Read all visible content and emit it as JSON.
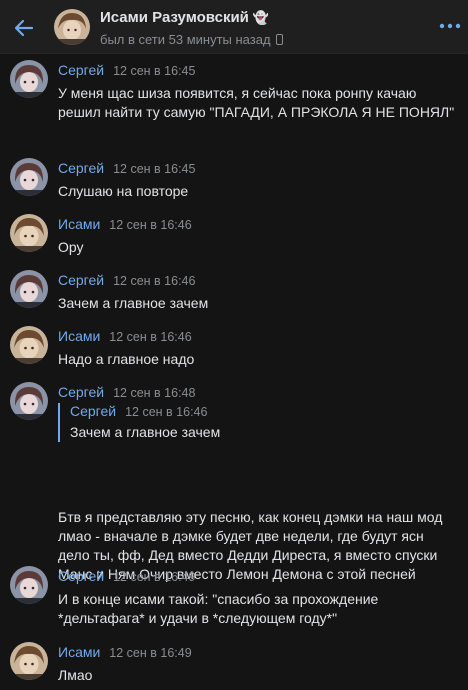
{
  "header": {
    "title": "Исами Разумовский",
    "title_icon": "ghost-icon",
    "status": "был в сети 53 минуты назад"
  },
  "colors": {
    "accent": "#71aaeb",
    "background": "#141414",
    "header_bg": "#1f1f1f"
  },
  "messages": [
    {
      "author": "Сергей",
      "time": "12 сен в 16:45",
      "text": "У меня щас шиза появится, я сейчас пока ронпу качаю решил найти ту самую \"ПАГАДИ, А ПРЭКОЛА Я НЕ ПОНЯЛ\""
    },
    {
      "author": "Сергей",
      "time": "12 сен в 16:45",
      "text": "Слушаю на повторе"
    },
    {
      "author": "Исами",
      "time": "12 сен в 16:46",
      "text": "Ору"
    },
    {
      "author": "Сергей",
      "time": "12 сен в 16:46",
      "text": "Зачем а главное зачем"
    },
    {
      "author": "Исами",
      "time": "12 сен в 16:46",
      "text": "Надо а главное надо"
    },
    {
      "author": "Сергей",
      "time": "12 сен в 16:48",
      "quote": {
        "author": "Сергей",
        "time": "12 сен в 16:46",
        "text": "Зачем а главное зачем"
      },
      "text": "Бтв я представляю эту песню, как конец дэмки на наш мод лмао - вначале в дэмке будет две недели, где будут ясн дело ты, фф, Дед вместо Дедди Диреста, я вместо спуски Манс и Ням Очир вместо Лемон Демона с этой песней"
    },
    {
      "author": "Сергей",
      "time": "12 сен в 16:49",
      "text": "И в конце исами такой: \"спасибо за прохождение *дельтафага* и удачи в *следующем году*\""
    },
    {
      "author": "Исами",
      "time": "12 сен в 16:49",
      "text": "Лмао"
    }
  ]
}
